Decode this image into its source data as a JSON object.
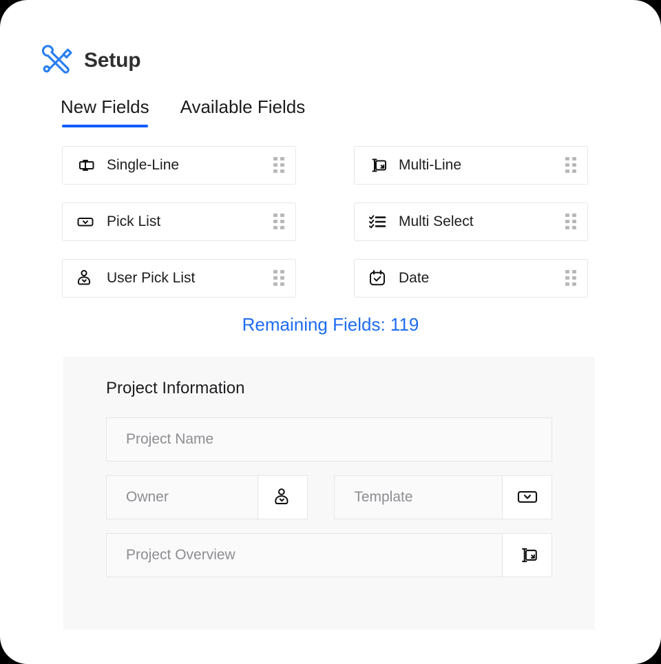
{
  "header": {
    "icon": "setup-tools-icon",
    "title": "Setup"
  },
  "tabs": [
    {
      "label": "New Fields",
      "active": true
    },
    {
      "label": "Available Fields",
      "active": false
    }
  ],
  "field_types": [
    {
      "label": "Single-Line",
      "icon": "single-line-icon",
      "handle": "drag-handle-icon"
    },
    {
      "label": "Multi-Line",
      "icon": "multi-line-icon",
      "handle": "drag-handle-icon"
    },
    {
      "label": "Pick List",
      "icon": "pick-list-icon",
      "handle": "drag-handle-icon"
    },
    {
      "label": "Multi Select",
      "icon": "multi-select-icon",
      "handle": "drag-handle-icon"
    },
    {
      "label": "User Pick List",
      "icon": "user-pick-list-icon",
      "handle": "drag-handle-icon"
    },
    {
      "label": "Date",
      "icon": "date-icon",
      "handle": "drag-handle-icon"
    }
  ],
  "remaining_fields": {
    "text": "Remaining Fields: 119",
    "count": 119,
    "color": "#1d6cf2"
  },
  "form": {
    "title": "Project Information",
    "rows": [
      {
        "fields": [
          {
            "placeholder": "Project Name",
            "value": "",
            "addon_icon": null
          }
        ]
      },
      {
        "fields": [
          {
            "placeholder": "Owner",
            "value": "",
            "addon_icon": "user-pick-list-icon"
          },
          {
            "placeholder": "Template",
            "value": "",
            "addon_icon": "pick-list-icon"
          }
        ]
      },
      {
        "fields": [
          {
            "placeholder": "Project Overview",
            "value": "",
            "addon_icon": "multi-line-icon"
          }
        ]
      }
    ]
  },
  "colors": {
    "accent": "#0b5cff",
    "link": "#1d6cf2",
    "panel_bg": "#f8f8f9",
    "card_border": "#e6e6e8",
    "text": "#1c1c1e",
    "placeholder": "#8d8d92"
  }
}
